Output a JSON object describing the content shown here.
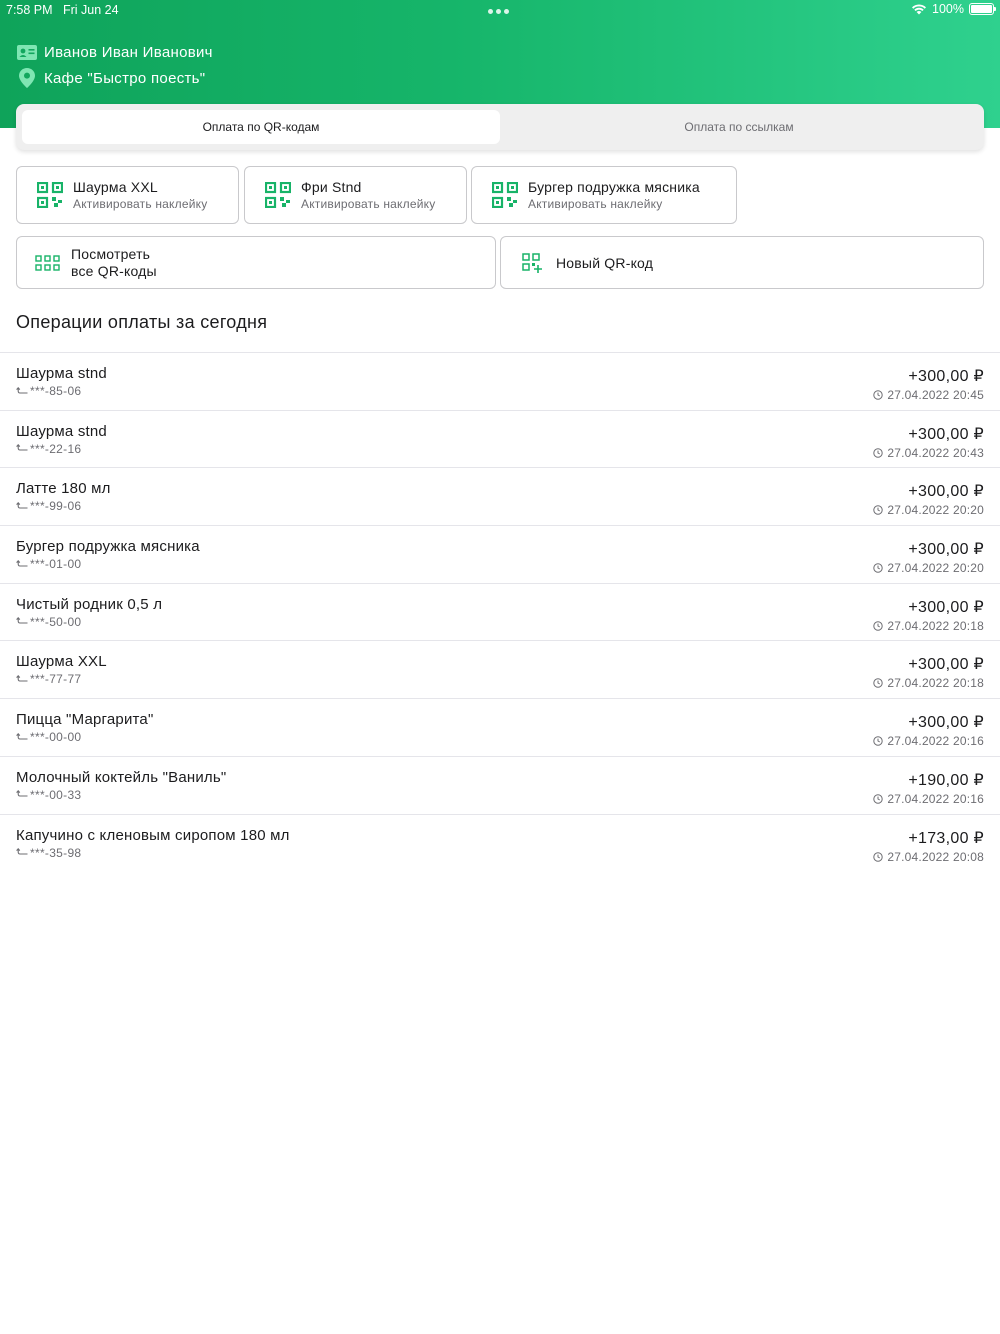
{
  "status_bar": {
    "time": "7:58 PM",
    "date": "Fri Jun 24",
    "battery": "100%",
    "battery_level": 1.0
  },
  "profile": {
    "user_name": "Иванов Иван Иванович",
    "place": "Кафе \"Быстро поесть\""
  },
  "tabs": [
    {
      "label": "Оплата по QR-кодам",
      "active": true
    },
    {
      "label": "Оплата по ссылкам",
      "active": false
    }
  ],
  "qr_cards": [
    {
      "title": "Шаурма XXL",
      "subtitle": "Активировать наклейку"
    },
    {
      "title": "Фри Stnd",
      "subtitle": "Активировать наклейку"
    },
    {
      "title": "Бургер подружка мясника",
      "subtitle": "Активировать наклейку"
    }
  ],
  "actions": {
    "view_all_line1": "Посмотреть",
    "view_all_line2": "все QR-коды",
    "new_qr": "Новый QR-код"
  },
  "section_title": "Операции оплаты за сегодня",
  "operations": [
    {
      "name": "Шаурма stnd",
      "card": "***-85-06",
      "amount": "+300,00 ₽",
      "time": "27.04.2022 20:45"
    },
    {
      "name": "Шаурма stnd",
      "card": "***-22-16",
      "amount": "+300,00 ₽",
      "time": "27.04.2022 20:43"
    },
    {
      "name": "Латте 180 мл",
      "card": "***-99-06",
      "amount": "+300,00 ₽",
      "time": "27.04.2022 20:20"
    },
    {
      "name": "Бургер подружка мясника",
      "card": "***-01-00",
      "amount": "+300,00 ₽",
      "time": "27.04.2022 20:20"
    },
    {
      "name": "Чистый родник 0,5 л",
      "card": "***-50-00",
      "amount": "+300,00 ₽",
      "time": "27.04.2022 20:18"
    },
    {
      "name": "Шаурма XXL",
      "card": "***-77-77",
      "amount": "+300,00 ₽",
      "time": "27.04.2022 20:18"
    },
    {
      "name": "Пицца \"Маргарита\"",
      "card": "***-00-00",
      "amount": "+300,00 ₽",
      "time": "27.04.2022 20:16"
    },
    {
      "name": "Молочный коктейль \"Ваниль\"",
      "card": "***-00-33",
      "amount": "+190,00 ₽",
      "time": "27.04.2022 20:16"
    },
    {
      "name": "Капучино с кленовым сиропом 180 мл",
      "card": "***-35-98",
      "amount": "+173,00 ₽",
      "time": "27.04.2022 20:08"
    }
  ],
  "colors": {
    "accent": "#18b368",
    "header_start": "#0fa35a",
    "header_end": "#2fd18e"
  }
}
